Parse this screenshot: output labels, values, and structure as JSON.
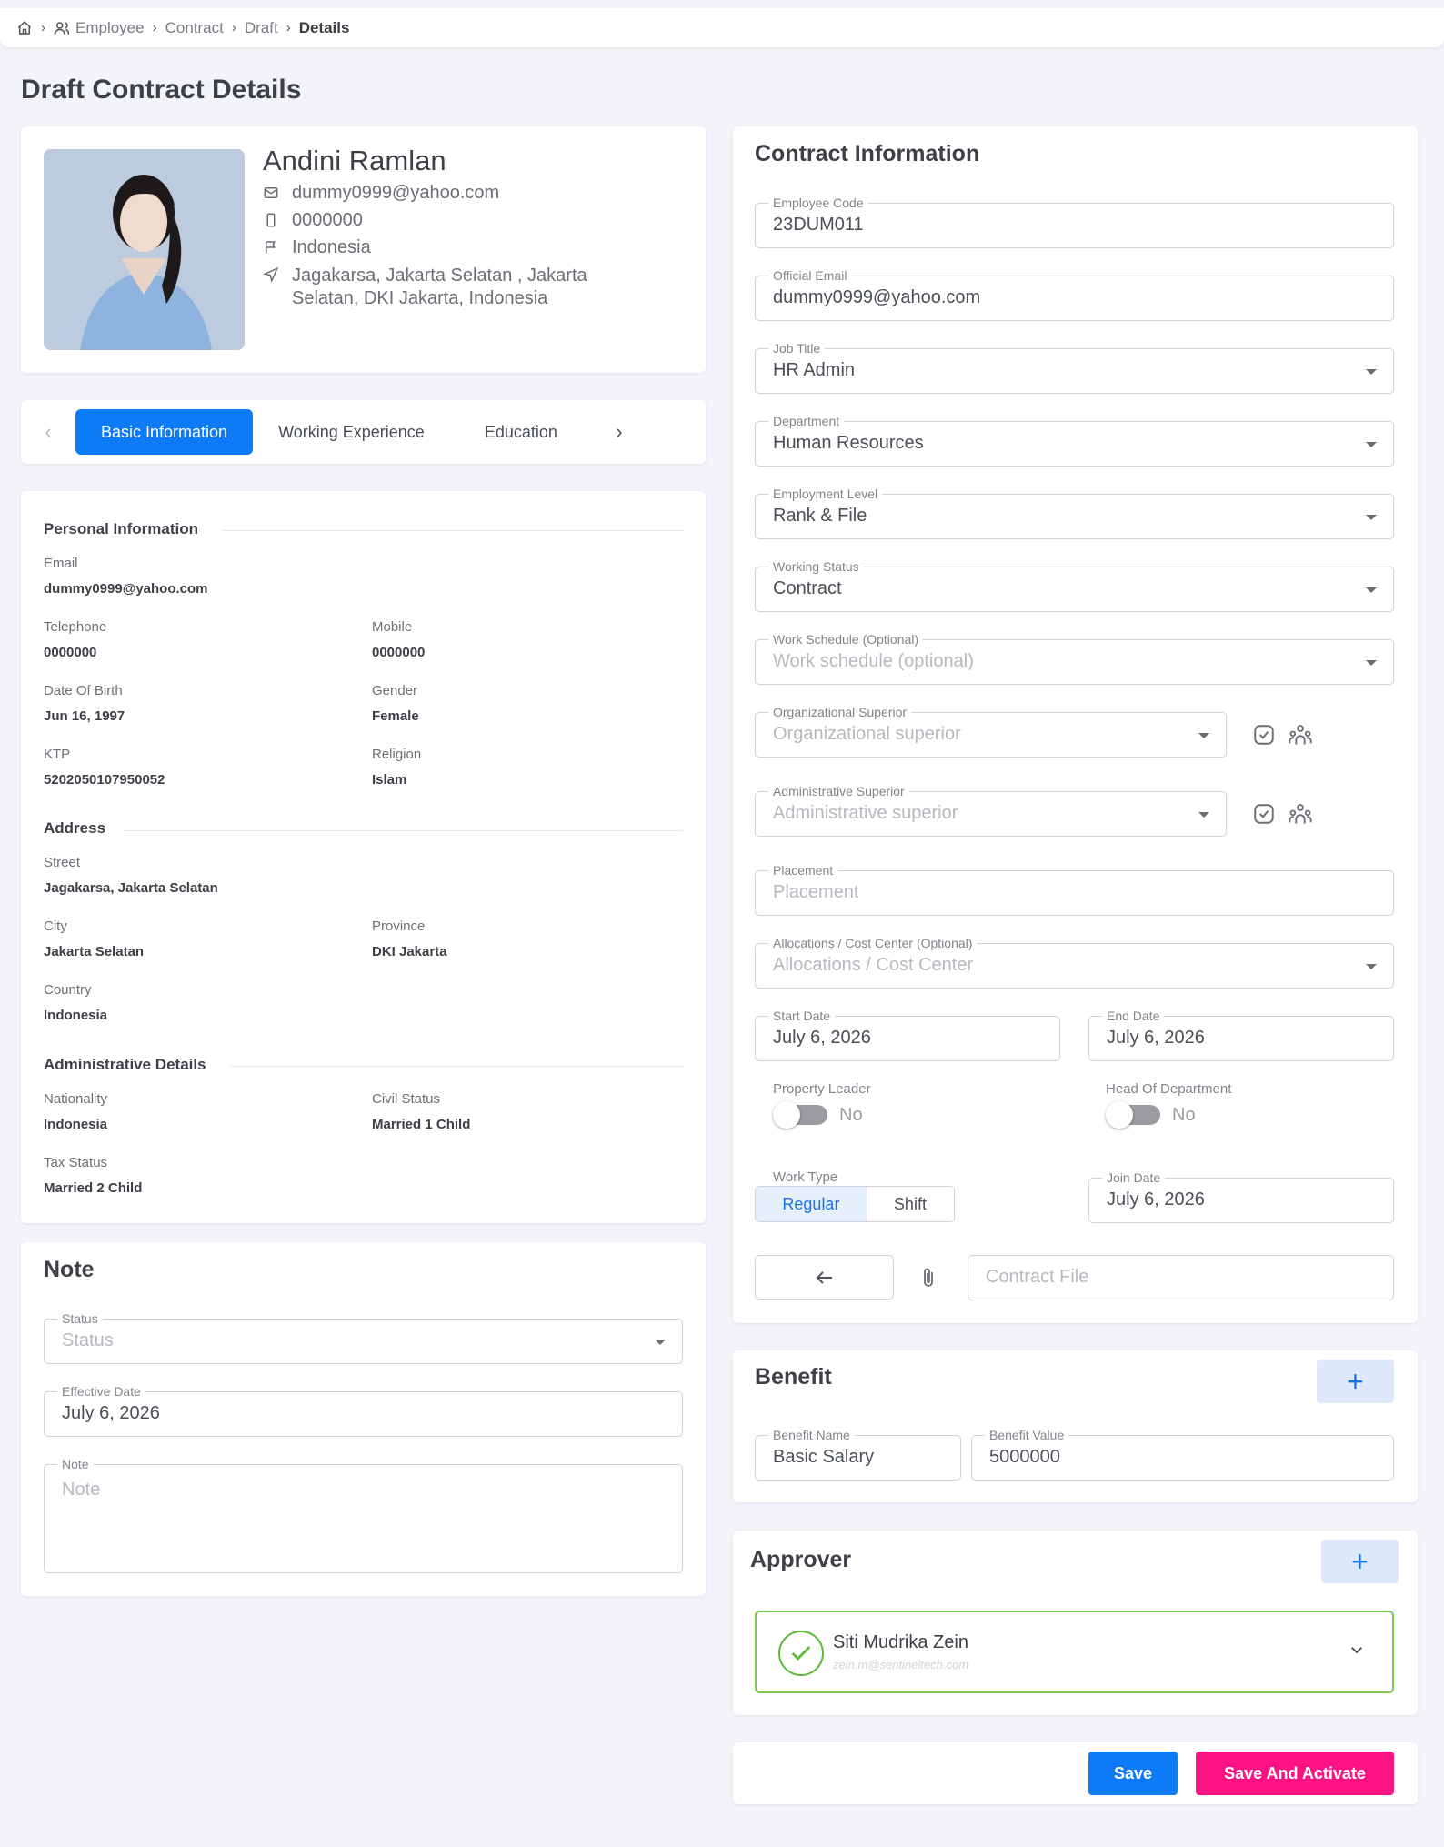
{
  "breadcrumb": {
    "items": [
      "Employee",
      "Contract",
      "Draft"
    ],
    "current": "Details"
  },
  "page_title": "Draft Contract Details",
  "profile": {
    "name": "Andini Ramlan",
    "email": "dummy0999@yahoo.com",
    "phone": "0000000",
    "country": "Indonesia",
    "address": "Jagakarsa, Jakarta Selatan ,  Jakarta Selatan,  DKI Jakarta,  Indonesia"
  },
  "tabs": [
    "Basic Information",
    "Working Experience",
    "Education"
  ],
  "personal": {
    "heading": "Personal Information",
    "email_label": "Email",
    "email": "dummy0999@yahoo.com",
    "telephone_label": "Telephone",
    "telephone": "0000000",
    "mobile_label": "Mobile",
    "mobile": "0000000",
    "dob_label": "Date Of Birth",
    "dob": "Jun 16, 1997",
    "gender_label": "Gender",
    "gender": "Female",
    "ktp_label": "KTP",
    "ktp": "5202050107950052",
    "religion_label": "Religion",
    "religion": "Islam"
  },
  "address": {
    "heading": "Address",
    "street_label": "Street",
    "street": "Jagakarsa, Jakarta Selatan",
    "city_label": "City",
    "city": "Jakarta Selatan",
    "province_label": "Province",
    "province": "DKI Jakarta",
    "country_label": "Country",
    "country": "Indonesia"
  },
  "admin": {
    "heading": "Administrative Details",
    "nationality_label": "Nationality",
    "nationality": "Indonesia",
    "civil_label": "Civil Status",
    "civil": "Married 1 Child",
    "tax_label": "Tax Status",
    "tax": "Married 2 Child"
  },
  "note": {
    "title": "Note",
    "status_label": "Status",
    "status_placeholder": "Status",
    "effective_label": "Effective Date",
    "effective": "July 6, 2026",
    "note_label": "Note",
    "note_placeholder": "Note"
  },
  "contract": {
    "title": "Contract Information",
    "employee_code_label": "Employee Code",
    "employee_code": "23DUM011",
    "official_email_label": "Official Email",
    "official_email": "dummy0999@yahoo.com",
    "job_title_label": "Job Title",
    "job_title": "HR Admin",
    "department_label": "Department",
    "department": "Human Resources",
    "level_label": "Employment Level",
    "level": "Rank & File",
    "working_status_label": "Working Status",
    "working_status": "Contract",
    "schedule_label": "Work Schedule (Optional)",
    "schedule_placeholder": "Work schedule (optional)",
    "org_superior_label": "Organizational Superior",
    "org_superior_placeholder": "Organizational superior",
    "admin_superior_label": "Administrative Superior",
    "admin_superior_placeholder": "Administrative superior",
    "placement_label": "Placement",
    "placement_placeholder": "Placement",
    "allocations_label": "Allocations / Cost Center (Optional)",
    "allocations_placeholder": "Allocations / Cost Center",
    "start_label": "Start Date",
    "start": "July 6, 2026",
    "end_label": "End Date",
    "end": "July 6, 2026",
    "property_leader_label": "Property Leader",
    "property_leader": "No",
    "head_label": "Head Of Department",
    "head": "No",
    "work_type_label": "Work Type",
    "work_type_options": [
      "Regular",
      "Shift"
    ],
    "join_label": "Join Date",
    "join": "July 6, 2026",
    "contract_file_placeholder": "Contract File"
  },
  "benefit": {
    "title": "Benefit",
    "name_label": "Benefit Name",
    "name": "Basic Salary",
    "value_label": "Benefit Value",
    "value": "5000000"
  },
  "approver": {
    "title": "Approver",
    "name": "Siti Mudrika Zein",
    "email": "zein.m@sentineltech.com"
  },
  "actions": {
    "save": "Save",
    "save_activate": "Save And Activate"
  }
}
